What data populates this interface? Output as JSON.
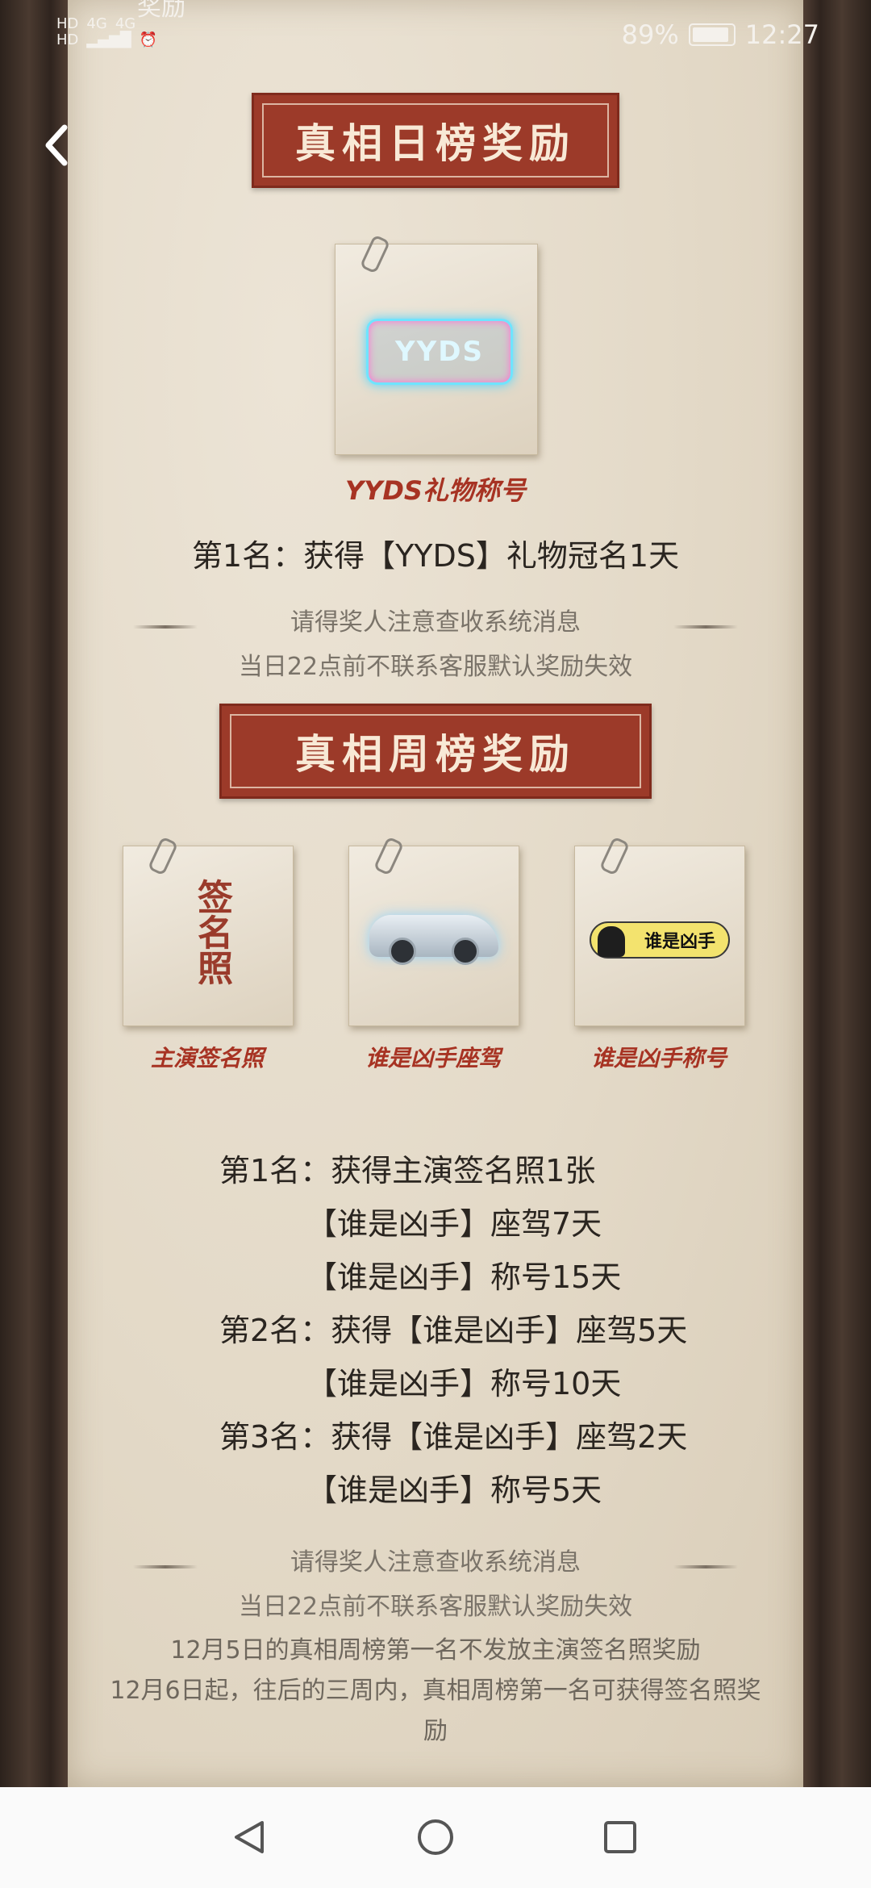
{
  "status_bar": {
    "left_top": "HD",
    "left_bottom": "HD",
    "signal1": "4G",
    "signal2": "4G",
    "battery_text": "89%",
    "time": "12:27",
    "partial_title": "奖励"
  },
  "daily": {
    "banner": "真相日榜奖励",
    "reward_label": "YYDS礼物称号",
    "badge_text": "YYDS",
    "rank1": "第1名：获得【YYDS】礼物冠名1天",
    "notice1": "请得奖人注意查收系统消息",
    "notice2": "当日22点前不联系客服默认奖励失效"
  },
  "weekly": {
    "banner": "真相周榜奖励",
    "cards": [
      {
        "label": "主演签名照",
        "image_text": "签名照"
      },
      {
        "label": "谁是凶手座驾"
      },
      {
        "label": "谁是凶手称号",
        "image_text": "谁是凶手"
      }
    ],
    "ranks": [
      "第1名：获得主演签名照1张",
      "【谁是凶手】座驾7天",
      "【谁是凶手】称号15天",
      "第2名：获得【谁是凶手】座驾5天",
      "【谁是凶手】称号10天",
      "第3名：获得【谁是凶手】座驾2天",
      "【谁是凶手】称号5天"
    ],
    "notice1": "请得奖人注意查收系统消息",
    "notice2": "当日22点前不联系客服默认奖励失效",
    "notice3": "12月5日的真相周榜第一名不发放主演签名照奖励",
    "notice4": "12月6日起，往后的三周内，真相周榜第一名可获得签名照奖",
    "notice5": "励"
  },
  "colors": {
    "banner_red": "#9c3a29",
    "label_red": "#a73323",
    "paper": "#e3d9c7"
  },
  "icons": {
    "back": "chevron-left-icon",
    "nav_back": "triangle-back-icon",
    "nav_home": "circle-home-icon",
    "nav_recent": "square-recent-icon"
  }
}
